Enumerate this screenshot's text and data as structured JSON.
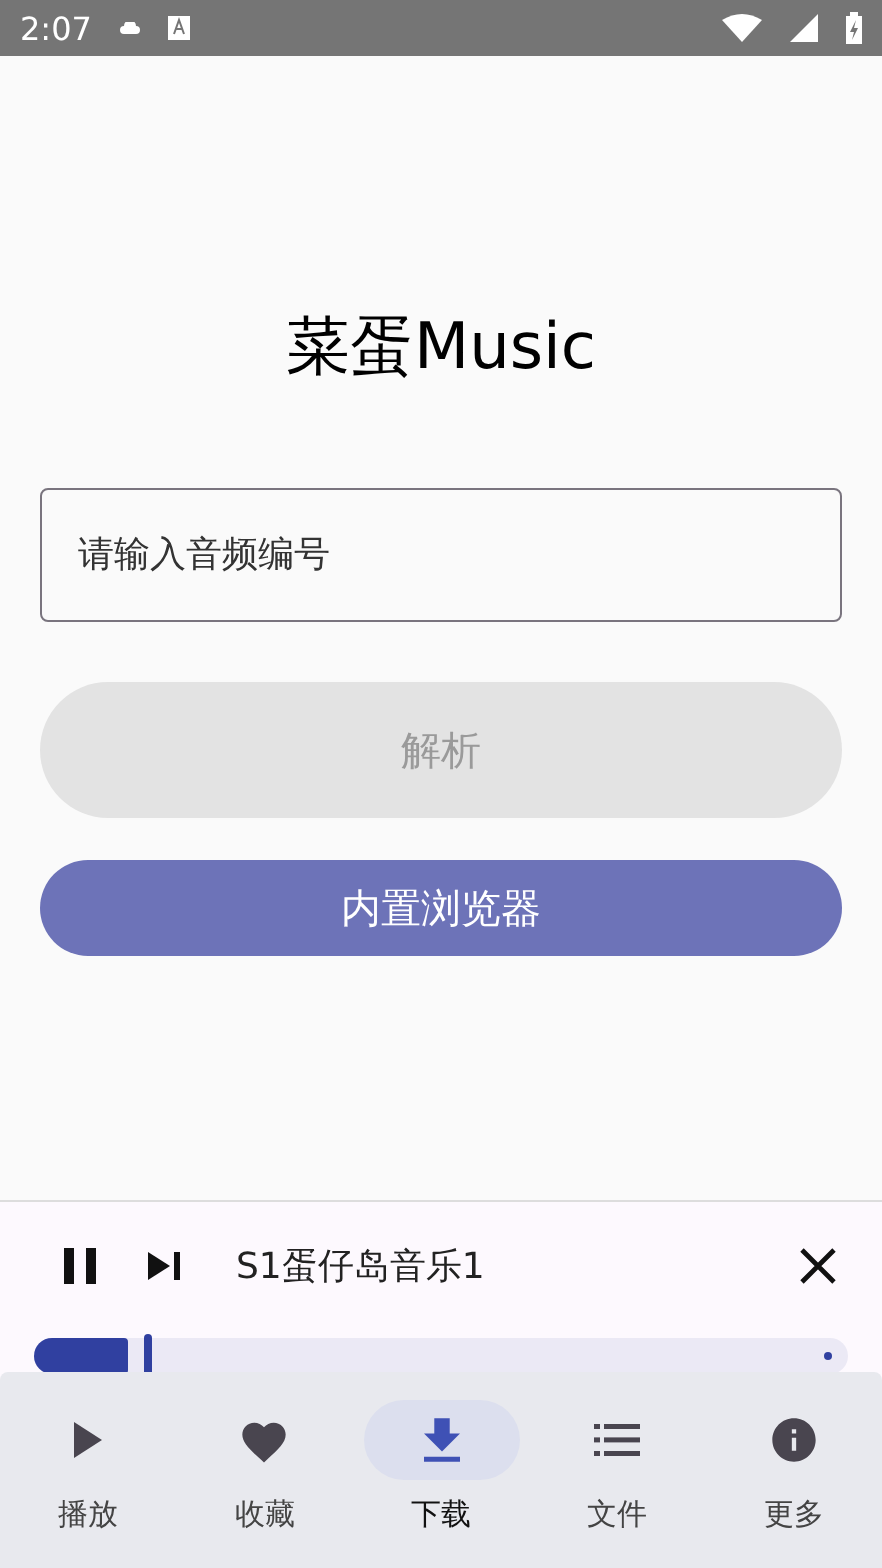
{
  "status_bar": {
    "time": "2:07"
  },
  "app_title": "菜蛋Music",
  "audio_id_field": {
    "placeholder": "请输入音频编号"
  },
  "parse_button": {
    "label": "解析",
    "disabled": true
  },
  "browser_button": {
    "label": "内置浏览器",
    "disabled": false
  },
  "player": {
    "playing": true,
    "track_title": "S1蛋仔岛音乐1",
    "progress": {
      "level": 0.14
    }
  },
  "nav": [
    {
      "label": "播放",
      "kind": "play",
      "selected": false
    },
    {
      "label": "收藏",
      "kind": "heart",
      "selected": false
    },
    {
      "label": "下载",
      "kind": "download",
      "selected": true
    },
    {
      "label": "文件",
      "kind": "list",
      "selected": false
    },
    {
      "label": "更多",
      "kind": "info",
      "selected": false
    }
  ]
}
